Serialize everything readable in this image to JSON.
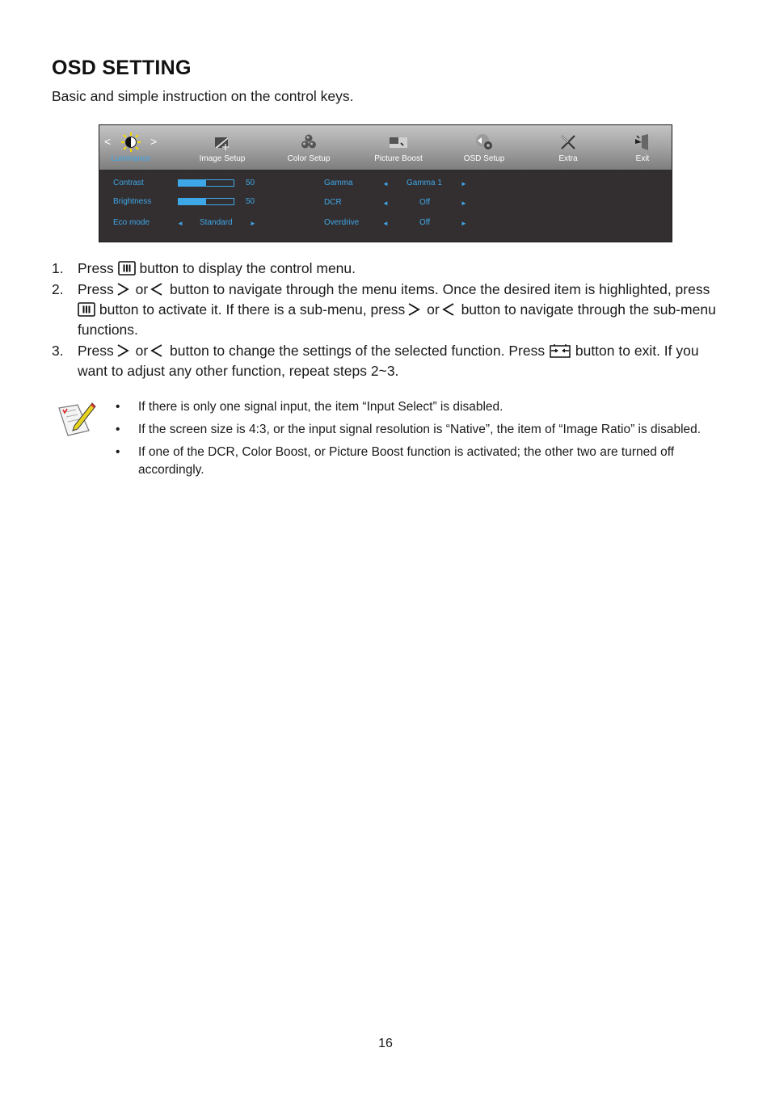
{
  "header": {
    "title": "OSD SETTING",
    "subtitle": "Basic and simple instruction on the control keys."
  },
  "osd": {
    "tabs": [
      {
        "label": "Luminance",
        "icon": "luminance-icon",
        "active": true
      },
      {
        "label": "Image Setup",
        "icon": "image-setup-icon",
        "active": false
      },
      {
        "label": "Color Setup",
        "icon": "color-setup-icon",
        "active": false
      },
      {
        "label": "Picture Boost",
        "icon": "picture-boost-icon",
        "active": false
      },
      {
        "label": "OSD Setup",
        "icon": "osd-setup-icon",
        "active": false
      },
      {
        "label": "Extra",
        "icon": "extra-icon",
        "active": false
      },
      {
        "label": "Exit",
        "icon": "exit-icon",
        "active": false
      }
    ],
    "nav_left": "<",
    "nav_right": ">",
    "left_settings": {
      "contrast": {
        "label": "Contrast",
        "value": "50",
        "level_percent": 50
      },
      "brightness": {
        "label": "Brightness",
        "value": "50",
        "level_percent": 50
      },
      "eco_mode": {
        "label": "Eco mode",
        "value": "Standard"
      }
    },
    "right_settings": {
      "gamma": {
        "label": "Gamma",
        "value": "Gamma 1"
      },
      "dcr": {
        "label": "DCR",
        "value": "Off"
      },
      "overdrive": {
        "label": "Overdrive",
        "value": "Off"
      }
    },
    "arrow_left": "◄",
    "arrow_right": "►",
    "accent_color": "#3ea7e8"
  },
  "steps": [
    {
      "num": "1.",
      "parts": [
        "Press",
        "button to display the control menu."
      ]
    },
    {
      "num": "2.",
      "parts": [
        "Press",
        "or",
        "button to navigate through the menu items. Once the desired item is highlighted, press",
        "button to activate it. If there is a sub-menu, press",
        "or",
        "button to navigate through the sub-menu functions."
      ]
    },
    {
      "num": "3.",
      "parts": [
        "Press",
        "or",
        "button to change the settings of the selected function. Press",
        "button to exit. If you want to adjust any other function, repeat steps 2~3."
      ]
    }
  ],
  "notes": {
    "bullet": "•",
    "items": [
      "If there is only one signal input, the item “Input Select” is disabled.",
      "If the screen size is 4:3, or the input signal resolution is “Native”, the item of “Image Ratio” is disabled.",
      "If one of the DCR, Color Boost, or Picture Boost function is activated; the other two are turned off accordingly."
    ]
  },
  "page_number": "16"
}
